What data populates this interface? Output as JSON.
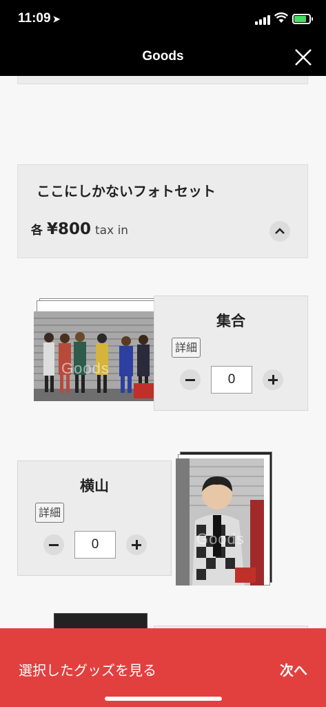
{
  "status_bar": {
    "time": "11:09",
    "location_icon": "location-arrow-icon",
    "battery_color": "#4cd964"
  },
  "nav": {
    "title": "Goods",
    "close_icon": "close-icon"
  },
  "section": {
    "title": "ここにしかないフォトセット",
    "price_each": "各",
    "price": "¥800",
    "tax": "tax in"
  },
  "items": [
    {
      "name": "集合",
      "detail_label": "詳細",
      "quantity": "0",
      "watermark": "Goods"
    },
    {
      "name": "横山",
      "detail_label": "詳細",
      "quantity": "0",
      "watermark": "Goods"
    }
  ],
  "bottom_bar": {
    "label": "選択したグッズを見る",
    "next": "次へ",
    "color": "#e2403f"
  }
}
